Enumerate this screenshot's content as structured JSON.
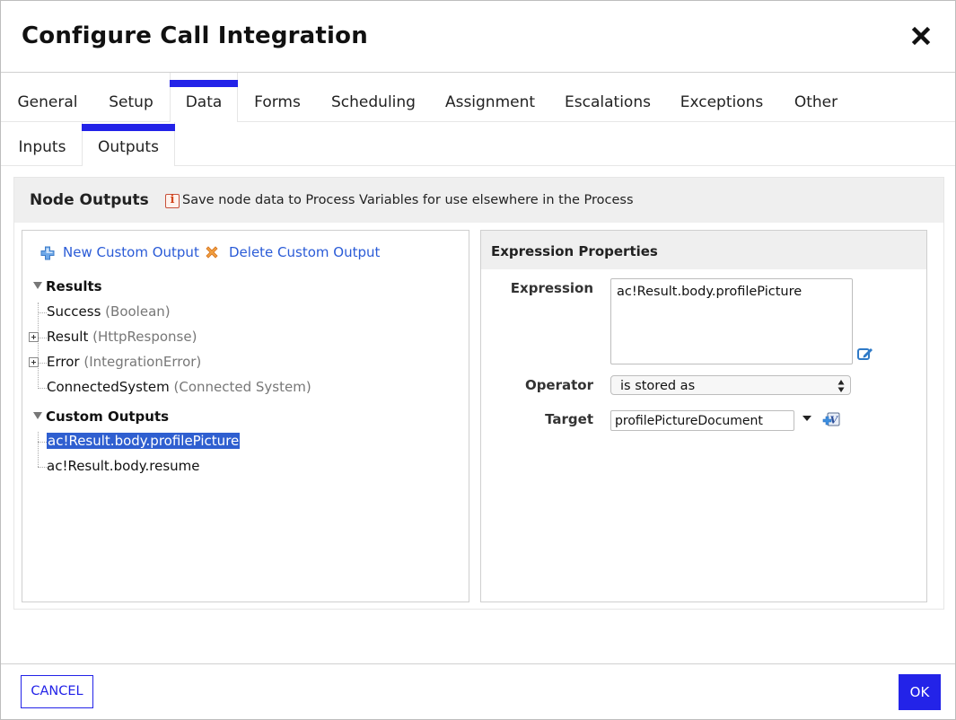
{
  "dialog": {
    "title": "Configure Call Integration",
    "close_icon": "close-icon"
  },
  "tabs": [
    {
      "label": "General",
      "active": false
    },
    {
      "label": "Setup",
      "active": false
    },
    {
      "label": "Data",
      "active": true
    },
    {
      "label": "Forms",
      "active": false
    },
    {
      "label": "Scheduling",
      "active": false
    },
    {
      "label": "Assignment",
      "active": false
    },
    {
      "label": "Escalations",
      "active": false
    },
    {
      "label": "Exceptions",
      "active": false
    },
    {
      "label": "Other",
      "active": false
    }
  ],
  "subtabs": [
    {
      "label": "Inputs",
      "active": false
    },
    {
      "label": "Outputs",
      "active": true
    }
  ],
  "node_outputs": {
    "title": "Node Outputs",
    "info_icon": "info-icon",
    "info_text": "Save node data to Process Variables for use elsewhere in the Process",
    "actions": {
      "new_label": "New Custom Output",
      "new_icon": "plus-icon",
      "delete_label": "Delete Custom Output",
      "delete_icon": "delete-x-icon"
    },
    "tree": {
      "results_label": "Results",
      "results": [
        {
          "name": "Success",
          "type": "(Boolean)",
          "expandable": false
        },
        {
          "name": "Result",
          "type": "(HttpResponse)",
          "expandable": true
        },
        {
          "name": "Error",
          "type": "(IntegrationError)",
          "expandable": true
        },
        {
          "name": "ConnectedSystem",
          "type": "(Connected System)",
          "expandable": false
        }
      ],
      "custom_label": "Custom Outputs",
      "custom": [
        {
          "name": "ac!Result.body.profilePicture",
          "selected": true
        },
        {
          "name": "ac!Result.body.resume",
          "selected": false
        }
      ]
    }
  },
  "expression_properties": {
    "title": "Expression Properties",
    "expression_label": "Expression",
    "expression_value": "ac!Result.body.profilePicture",
    "operator_label": "Operator",
    "operator_value": "is stored as",
    "target_label": "Target",
    "target_value": "profilePictureDocument"
  },
  "footer": {
    "cancel_label": "CANCEL",
    "ok_label": "OK"
  },
  "colors": {
    "accent": "#2323e8",
    "link": "#2a5bd7",
    "selection": "#2f5fd0"
  }
}
